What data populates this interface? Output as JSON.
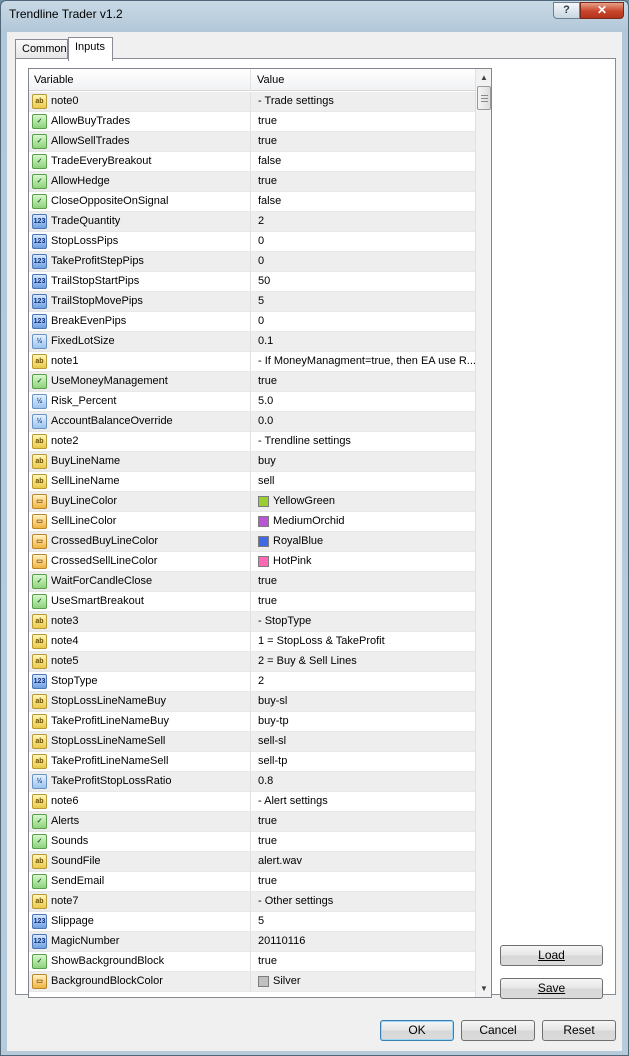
{
  "window": {
    "title": "Trendline Trader v1.2",
    "help_label": "?",
    "close_label": "✕"
  },
  "tabs": [
    {
      "label": "Common"
    },
    {
      "label": "Inputs"
    }
  ],
  "table": {
    "columns": {
      "variable": "Variable",
      "value": "Value"
    },
    "rows": [
      {
        "name": "note0",
        "value": "- Trade settings",
        "type": "str"
      },
      {
        "name": "AllowBuyTrades",
        "value": "true",
        "type": "bool"
      },
      {
        "name": "AllowSellTrades",
        "value": "true",
        "type": "bool"
      },
      {
        "name": "TradeEveryBreakout",
        "value": "false",
        "type": "bool"
      },
      {
        "name": "AllowHedge",
        "value": "true",
        "type": "bool"
      },
      {
        "name": "CloseOppositeOnSignal",
        "value": "false",
        "type": "bool"
      },
      {
        "name": "TradeQuantity",
        "value": "2",
        "type": "int"
      },
      {
        "name": "StopLossPips",
        "value": "0",
        "type": "int"
      },
      {
        "name": "TakeProfitStepPips",
        "value": "0",
        "type": "int"
      },
      {
        "name": "TrailStopStartPips",
        "value": "50",
        "type": "int"
      },
      {
        "name": "TrailStopMovePips",
        "value": "5",
        "type": "int"
      },
      {
        "name": "BreakEvenPips",
        "value": "0",
        "type": "int"
      },
      {
        "name": "FixedLotSize",
        "value": "0.1",
        "type": "dbl"
      },
      {
        "name": "note1",
        "value": "- If MoneyManagment=true, then EA use R...",
        "type": "str"
      },
      {
        "name": "UseMoneyManagement",
        "value": "true",
        "type": "bool"
      },
      {
        "name": "Risk_Percent",
        "value": "5.0",
        "type": "dbl"
      },
      {
        "name": "AccountBalanceOverride",
        "value": "0.0",
        "type": "dbl"
      },
      {
        "name": "note2",
        "value": "- Trendline settings",
        "type": "str"
      },
      {
        "name": "BuyLineName",
        "value": "buy",
        "type": "str"
      },
      {
        "name": "SellLineName",
        "value": "sell",
        "type": "str"
      },
      {
        "name": "BuyLineColor",
        "value": "YellowGreen",
        "type": "color",
        "swatch": "#9acd32"
      },
      {
        "name": "SellLineColor",
        "value": "MediumOrchid",
        "type": "color",
        "swatch": "#ba55d3"
      },
      {
        "name": "CrossedBuyLineColor",
        "value": "RoyalBlue",
        "type": "color",
        "swatch": "#4169e1"
      },
      {
        "name": "CrossedSellLineColor",
        "value": "HotPink",
        "type": "color",
        "swatch": "#ff69b4"
      },
      {
        "name": "WaitForCandleClose",
        "value": "true",
        "type": "bool"
      },
      {
        "name": "UseSmartBreakout",
        "value": "true",
        "type": "bool"
      },
      {
        "name": "note3",
        "value": "- StopType",
        "type": "str"
      },
      {
        "name": "note4",
        "value": "1 = StopLoss & TakeProfit",
        "type": "str"
      },
      {
        "name": "note5",
        "value": "2 = Buy & Sell Lines",
        "type": "str"
      },
      {
        "name": "StopType",
        "value": "2",
        "type": "int"
      },
      {
        "name": "StopLossLineNameBuy",
        "value": "buy-sl",
        "type": "str"
      },
      {
        "name": "TakeProfitLineNameBuy",
        "value": "buy-tp",
        "type": "str"
      },
      {
        "name": "StopLossLineNameSell",
        "value": "sell-sl",
        "type": "str"
      },
      {
        "name": "TakeProfitLineNameSell",
        "value": "sell-tp",
        "type": "str"
      },
      {
        "name": "TakeProfitStopLossRatio",
        "value": "0.8",
        "type": "dbl"
      },
      {
        "name": "note6",
        "value": "- Alert settings",
        "type": "str"
      },
      {
        "name": "Alerts",
        "value": "true",
        "type": "bool"
      },
      {
        "name": "Sounds",
        "value": "true",
        "type": "bool"
      },
      {
        "name": "SoundFile",
        "value": "alert.wav",
        "type": "str"
      },
      {
        "name": "SendEmail",
        "value": "true",
        "type": "bool"
      },
      {
        "name": "note7",
        "value": "- Other settings",
        "type": "str"
      },
      {
        "name": "Slippage",
        "value": "5",
        "type": "int"
      },
      {
        "name": "MagicNumber",
        "value": "20110116",
        "type": "int"
      },
      {
        "name": "ShowBackgroundBlock",
        "value": "true",
        "type": "bool"
      },
      {
        "name": "BackgroundBlockColor",
        "value": "Silver",
        "type": "color",
        "swatch": "#c0c0c0"
      }
    ]
  },
  "type_icons": {
    "str": {
      "glyph": "ab",
      "icon": "string-type-icon"
    },
    "bool": {
      "glyph": "✓",
      "icon": "bool-type-icon"
    },
    "int": {
      "glyph": "123",
      "icon": "int-type-icon"
    },
    "dbl": {
      "glyph": "½",
      "icon": "double-type-icon"
    },
    "color": {
      "glyph": "▭",
      "icon": "color-type-icon"
    }
  },
  "side_buttons": {
    "load_label": "Load",
    "save_label": "Save"
  },
  "footer_buttons": {
    "ok_label": "OK",
    "cancel_label": "Cancel",
    "reset_label": "Reset"
  }
}
